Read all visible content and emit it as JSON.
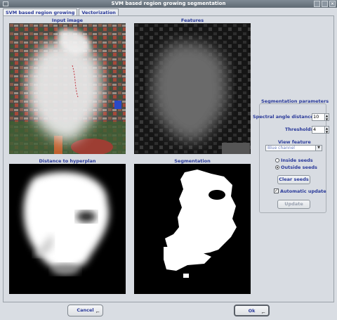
{
  "window": {
    "title": "SVM based region growing segmentation",
    "close_glyph": "×"
  },
  "tabs": [
    {
      "label": "SVM based region growing"
    },
    {
      "label": "Vectorization"
    }
  ],
  "images": {
    "input": "Input image",
    "features": "Features",
    "distance": "Distance to hyperplan",
    "segmentation": "Segmentation"
  },
  "params": {
    "title": "Segmentation parameters",
    "spectral_label": "Spectral angle distances",
    "spectral_value": "10",
    "thresholds_label": "Thresholds",
    "thresholds_value": "4",
    "view_feature_label": "View feature",
    "view_feature_value": "Blue channel",
    "inside_seeds": "Inside seeds",
    "outside_seeds": "Outside seeds",
    "clear_seeds": "Clear seeds",
    "auto_update": "Automatic update",
    "update": "Update"
  },
  "footer": {
    "cancel": "Cancel",
    "ok": "Ok"
  }
}
